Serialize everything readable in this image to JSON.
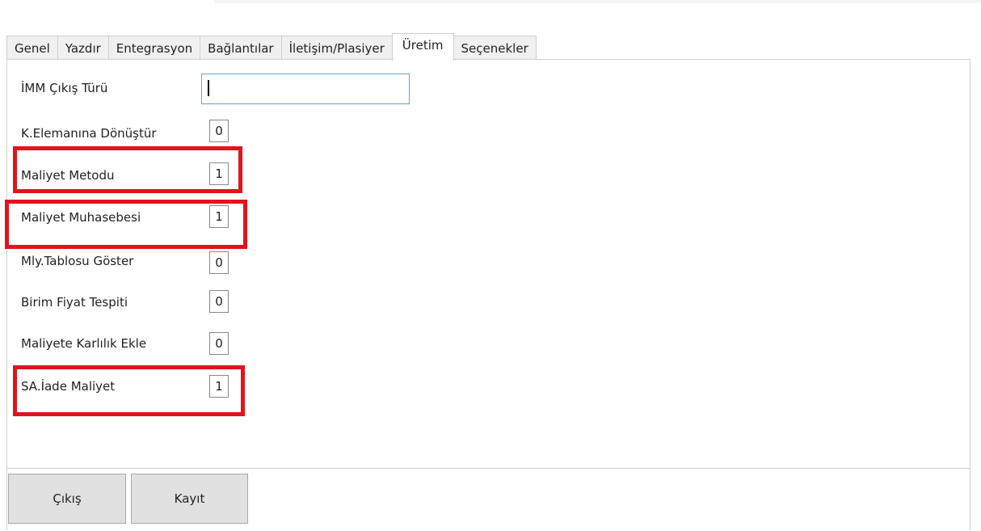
{
  "tabs": [
    {
      "label": "Genel"
    },
    {
      "label": "Yazdır"
    },
    {
      "label": "Entegrasyon"
    },
    {
      "label": "Bağlantılar"
    },
    {
      "label": "İletişim/Plasiyer"
    },
    {
      "label": "Üretim",
      "active": true
    },
    {
      "label": "Seçenekler"
    }
  ],
  "fields": {
    "imm_cikis_turu": {
      "label": "İMM Çıkış Türü",
      "value": ""
    },
    "k_elemanina_donustur": {
      "label": "K.Elemanına Dönüştür",
      "value": "0"
    },
    "maliyet_metodu": {
      "label": "Maliyet Metodu",
      "value": "1"
    },
    "maliyet_muhasebesi": {
      "label": "Maliyet Muhasebesi",
      "value": "1"
    },
    "mly_tablosu_goster": {
      "label": "Mly.Tablosu Göster",
      "value": "0"
    },
    "birim_fiyat_tespiti": {
      "label": "Birim Fiyat Tespiti",
      "value": "0"
    },
    "maliyete_karlilik_ekle": {
      "label": "Maliyete Karlılık Ekle",
      "value": "0"
    },
    "sa_iade_maliyet": {
      "label": "SA.İade Maliyet",
      "value": "1"
    }
  },
  "buttons": {
    "exit_label": "Çıkış",
    "save_label": "Kayıt"
  },
  "colors": {
    "highlight": "#e0141e",
    "input_focus_border": "#6aa3cf",
    "button_bg": "#e1e1e1"
  }
}
